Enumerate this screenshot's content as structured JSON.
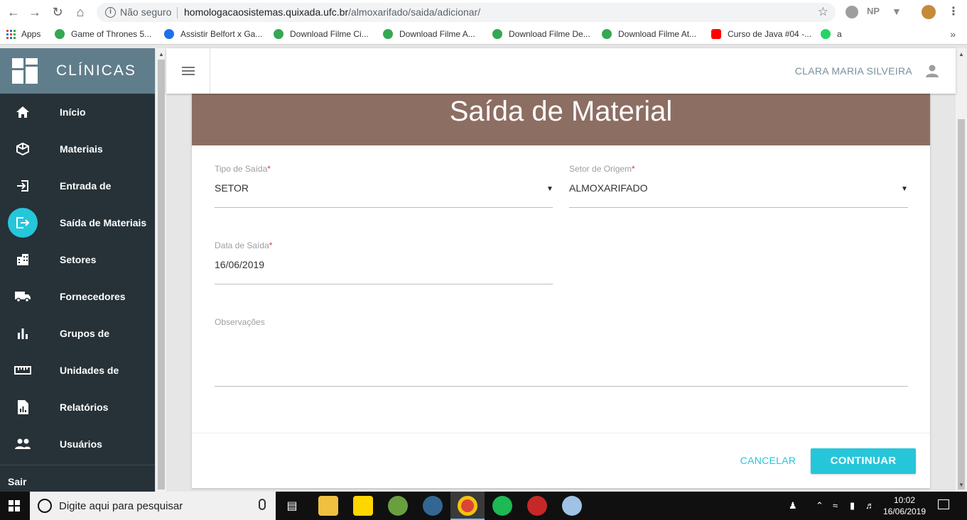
{
  "browser": {
    "security_label": "Não seguro",
    "url_host": "homologacaosistemas.quixada.ufc.br",
    "url_path": "/almoxarifado/saida/adicionar/",
    "ext_np": "NP",
    "bookmarks": [
      {
        "label": "Apps",
        "icon": "apps-grid-icon"
      },
      {
        "label": "Game of Thrones 5...",
        "color": "#34a853"
      },
      {
        "label": "Assistir Belfort x Ga...",
        "color": "#1a73e8"
      },
      {
        "label": "Download Filme Ci...",
        "color": "#34a853"
      },
      {
        "label": "Download Filme A...",
        "color": "#34a853"
      },
      {
        "label": "Download Filme De...",
        "color": "#34a853"
      },
      {
        "label": "Download Filme At...",
        "color": "#34a853"
      },
      {
        "label": "Curso de Java #04 -...",
        "color": "#ff0000"
      },
      {
        "label": "a",
        "color": "#25d366"
      }
    ]
  },
  "sidebar": {
    "brand": "CLÍNICAS",
    "items": [
      {
        "label": "Início",
        "icon": "home-icon"
      },
      {
        "label": "Materiais",
        "icon": "cube-icon"
      },
      {
        "label": "Entrada de",
        "icon": "login-icon"
      },
      {
        "label": "Saída de Materiais",
        "icon": "logout-icon",
        "active": true
      },
      {
        "label": "Setores",
        "icon": "building-icon"
      },
      {
        "label": "Fornecedores",
        "icon": "truck-icon"
      },
      {
        "label": "Grupos de",
        "icon": "bar-chart-icon"
      },
      {
        "label": "Unidades de",
        "icon": "ruler-icon"
      },
      {
        "label": "Relatórios",
        "icon": "report-icon"
      },
      {
        "label": "Usuários",
        "icon": "people-icon"
      }
    ],
    "logout": "Sair"
  },
  "header": {
    "user_name": "CLARA MARIA SILVEIRA"
  },
  "form": {
    "title": "Saída de Material",
    "tipo_saida": {
      "label": "Tipo de Saída",
      "required": "*",
      "value": "SETOR"
    },
    "setor_origem": {
      "label": "Setor de Origem",
      "required": "*",
      "value": "ALMOXARIFADO"
    },
    "data_saida": {
      "label": "Data de Saída",
      "required": "*",
      "value": "16/06/2019"
    },
    "observacoes": {
      "label": "Observações",
      "value": ""
    },
    "cancel_label": "CANCELAR",
    "continue_label": "CONTINUAR"
  },
  "taskbar": {
    "search_placeholder": "Digite aqui para pesquisar",
    "time": "10:02",
    "date": "16/06/2019"
  },
  "colors": {
    "sidebar_bg": "#263238",
    "brand_bg": "#607d8b",
    "header_band": "#8d6e63",
    "accent": "#26c6da"
  }
}
